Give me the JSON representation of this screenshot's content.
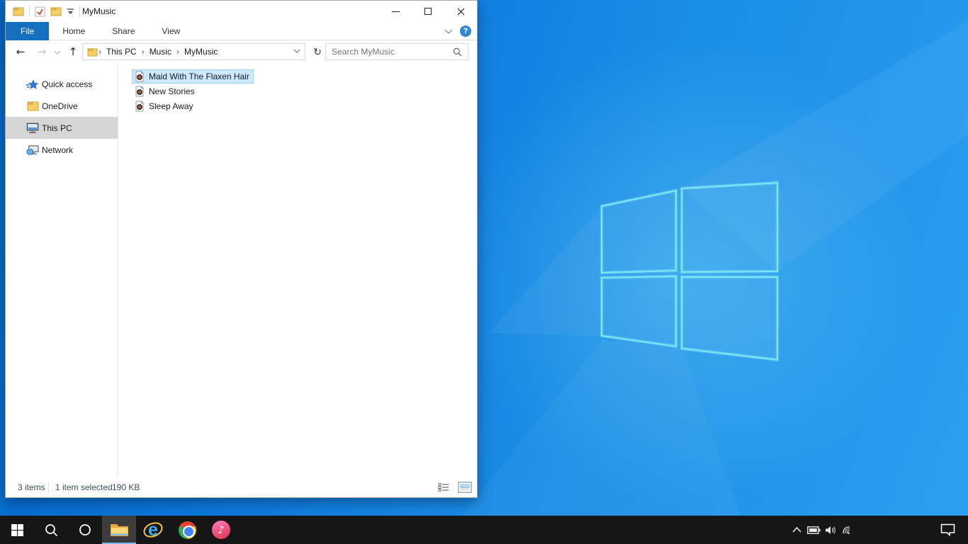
{
  "desktop": {
    "wallpaper": "windows-10-light-theme-logo"
  },
  "window": {
    "title": "MyMusic",
    "tabs": [
      "File",
      "Home",
      "Share",
      "View"
    ],
    "active_tab": "File",
    "help_glyph": "?",
    "nav": {
      "back": "←",
      "forward": "→",
      "up": "↑",
      "refresh": "↻"
    },
    "breadcrumb": {
      "separator": "›",
      "items": [
        "This PC",
        "Music",
        "MyMusic"
      ]
    },
    "search": {
      "placeholder": "Search MyMusic"
    },
    "sidebar": {
      "items": [
        {
          "label": "Quick access",
          "icon": "quick-access-star"
        },
        {
          "label": "OneDrive",
          "icon": "onedrive-folder"
        },
        {
          "label": "This PC",
          "icon": "this-pc-monitor",
          "selected": true
        },
        {
          "label": "Network",
          "icon": "network-computer"
        }
      ]
    },
    "files": {
      "items": [
        {
          "name": "Maid With The Flaxen Hair",
          "icon": "music-file",
          "selected": true
        },
        {
          "name": "New Stories",
          "icon": "music-file",
          "selected": false
        },
        {
          "name": "Sleep Away",
          "icon": "music-file",
          "selected": false
        }
      ]
    },
    "status": {
      "count": "3 items",
      "selected": "1 item selected",
      "size": "190 KB"
    }
  },
  "taskbar": {
    "buttons": [
      "start",
      "search",
      "cortana",
      "file-explorer",
      "internet-explorer",
      "chrome",
      "itunes"
    ],
    "active_button": "file-explorer",
    "ie_glyph": "e",
    "itunes_glyph": "♪",
    "tray_icons": [
      "hidden-icons-chevron",
      "battery",
      "volume",
      "wifi",
      "action-center"
    ]
  },
  "colors": {
    "file_tab_blue": "#1470be",
    "selection_bg": "#cce8ff",
    "selection_border": "#99d1ff",
    "sidebar_selected": "#d6d6d6",
    "taskbar_bg": "#161616",
    "taskbar_active_underline": "#76b9ed",
    "desktop_blue_dark": "#0566c4",
    "desktop_blue_light": "#2c9ff0",
    "logo_stroke": "#7be9f0",
    "help_circle": "#2f86d4",
    "status_text": "#3f4d63"
  }
}
